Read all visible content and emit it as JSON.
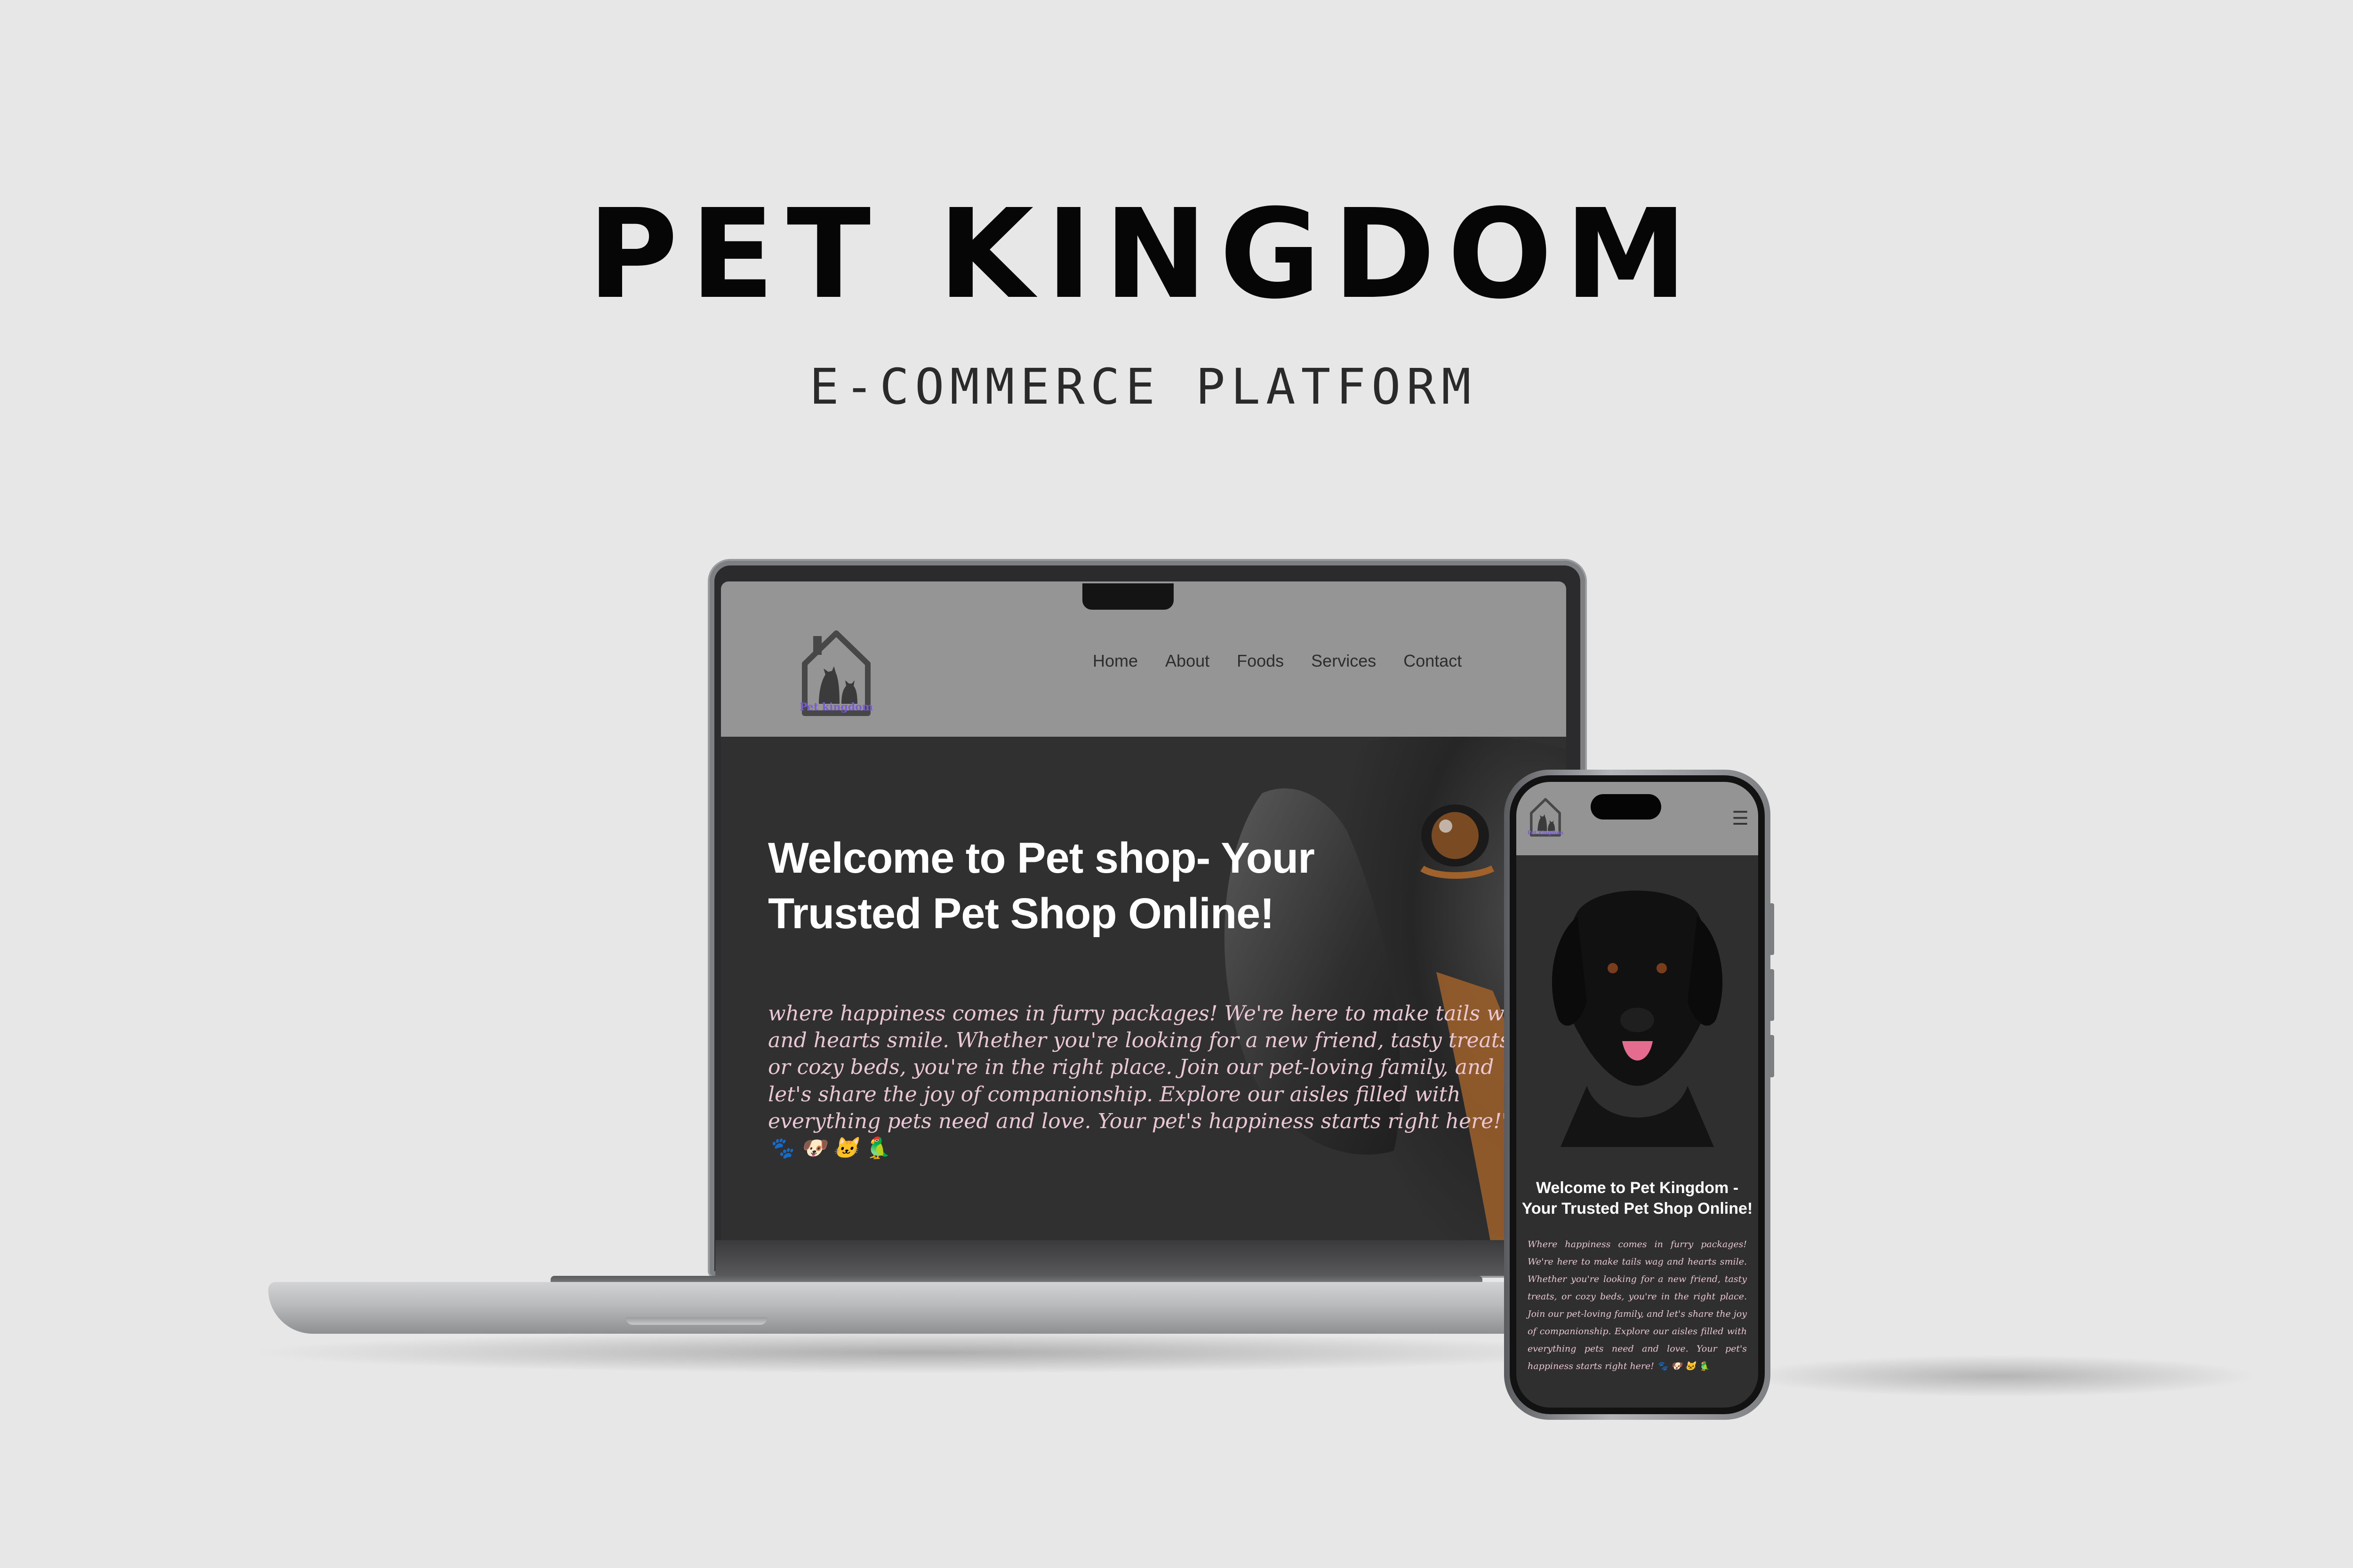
{
  "showcase": {
    "title": "PET KINGDOM",
    "subtitle": "E-COMMERCE PLATFORM"
  },
  "desktop_site": {
    "logo_text": "Pet kingdom",
    "nav": [
      "Home",
      "About",
      "Foods",
      "Services",
      "Contact"
    ],
    "hero_title": "Welcome to Pet shop- Your Trusted Pet Shop Online!",
    "hero_text": "where happiness comes in furry packages! We're here to make tails wag and hearts smile. Whether you're looking for a new friend, tasty treats, or cozy beds, you're in the right place. Join our pet-loving family, and let's share the joy of companionship. Explore our aisles filled with everything pets need and love. Your pet's happiness starts right here!\" 🐾 🐶 🐱 🦜"
  },
  "mobile_site": {
    "logo_text": "Pet kingdom",
    "menu_icon": "☰",
    "hero_title": "Welcome to Pet Kingdom - Your Trusted Pet Shop Online!",
    "hero_text": "Where happiness comes in furry packages! We're here to make tails wag and hearts smile. Whether you're looking for a new friend, tasty treats, or cozy beds, you're in the right place. Join our pet-loving family, and let's share the joy of companionship. Explore our aisles filled with everything pets need and love. Your pet's happiness starts right here! 🐾 🐶 🐱 🦜"
  },
  "colors": {
    "background": "#e7e7e7",
    "site_header": "#959595",
    "site_body": "#303030",
    "hero_text": "#e9c7d4",
    "logo_accent": "#7a5bd6"
  }
}
